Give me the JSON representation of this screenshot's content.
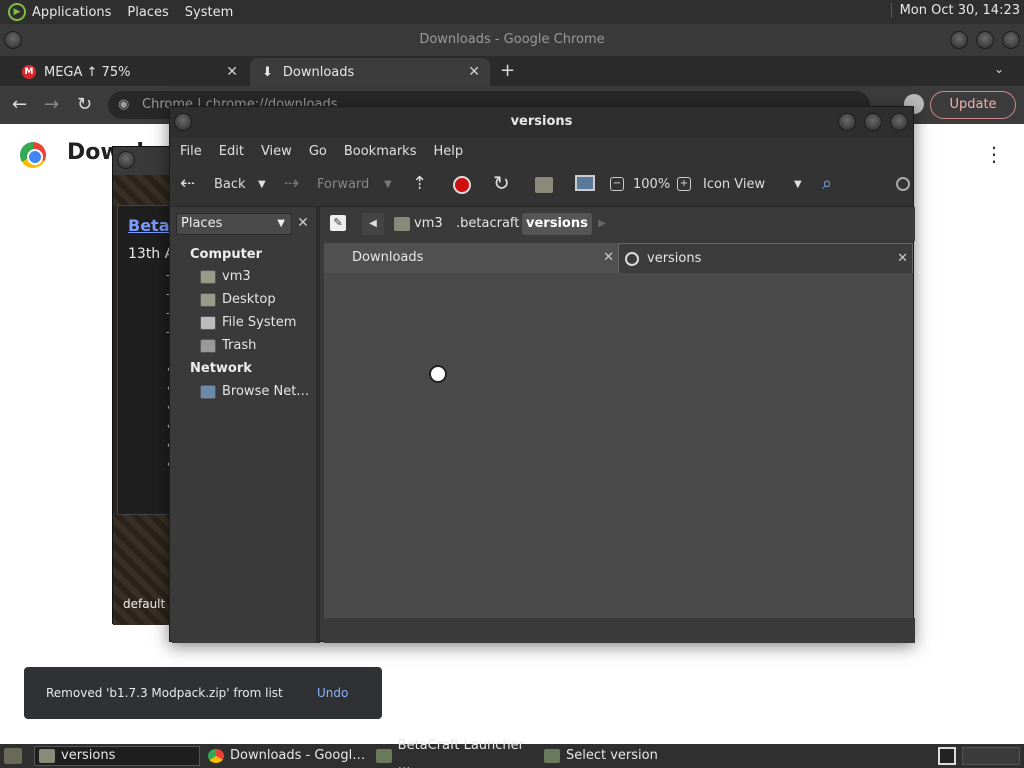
{
  "top_panel": {
    "menus": [
      "Applications",
      "Places",
      "System"
    ],
    "clock": "Mon Oct 30, 14:23"
  },
  "chrome": {
    "window_title": "Downloads - Google Chrome",
    "tabs": [
      {
        "label": "MEGA ↑ 75%"
      },
      {
        "label": "Downloads"
      }
    ],
    "new_tab": "+",
    "omnibox_text": "Chrome  |  chrome://downloads",
    "update_label": "Update",
    "page_title": "Downloads",
    "snackbar": {
      "message": "Removed 'b1.7.3 Modpack.zip' from list",
      "undo_label": "Undo"
    }
  },
  "betacraft": {
    "link_text": "BetaCraft",
    "date_text": "13th A",
    "profile_text": "default"
  },
  "nautilus": {
    "window_title": "versions",
    "menus": [
      "File",
      "Edit",
      "View",
      "Go",
      "Bookmarks",
      "Help"
    ],
    "toolbar": {
      "back_label": "Back",
      "forward_label": "Forward",
      "zoom_level": "100%",
      "view_mode": "Icon View"
    },
    "sidebar": {
      "combo_label": "Places",
      "sections": [
        {
          "header": "Computer",
          "items": [
            "vm3",
            "Desktop",
            "File System",
            "Trash"
          ]
        },
        {
          "header": "Network",
          "items": [
            "Browse Net…"
          ]
        }
      ]
    },
    "path": [
      "vm3",
      ".betacraft",
      "versions"
    ],
    "tabs": [
      {
        "label": "Downloads"
      },
      {
        "label": "versions"
      }
    ]
  },
  "taskbar": {
    "tasks": [
      {
        "label": "versions"
      },
      {
        "label": "Downloads - Googl…"
      },
      {
        "label": "BetaCraft Launcher …"
      },
      {
        "label": "Select version"
      }
    ]
  }
}
